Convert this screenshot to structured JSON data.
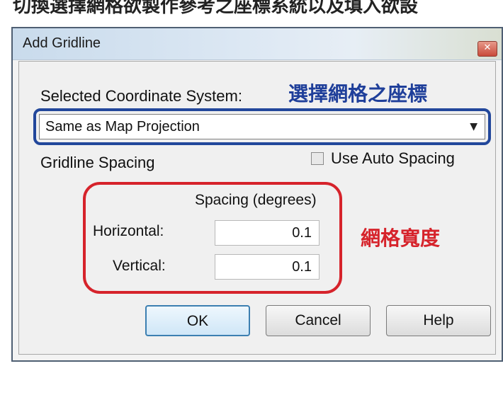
{
  "caption": "切換選擇網格欲製作參考之座標系統以及填入欲設",
  "dialog": {
    "title": "Add Gridline",
    "close_glyph": "✕",
    "coordinate_label": "Selected Coordinate System:",
    "coordinate_value": "Same as Map Projection",
    "gridline_spacing_label": "Gridline Spacing",
    "use_auto_spacing_label": "Use Auto Spacing",
    "use_auto_spacing_checked": false,
    "spacing_header": "Spacing (degrees)",
    "horizontal_label": "Horizontal:",
    "horizontal_value": "0.1",
    "vertical_label": "Vertical:",
    "vertical_value": "0.1",
    "buttons": {
      "ok": "OK",
      "cancel": "Cancel",
      "help": "Help"
    }
  },
  "annotations": {
    "coordinate_note": "選擇網格之座標",
    "spacing_note": "網格寬度"
  },
  "icons": {
    "dropdown": "chevron-down-icon",
    "close": "close-icon"
  },
  "colors": {
    "blue_annotation": "#1f3f9a",
    "red_annotation": "#d6232b"
  }
}
